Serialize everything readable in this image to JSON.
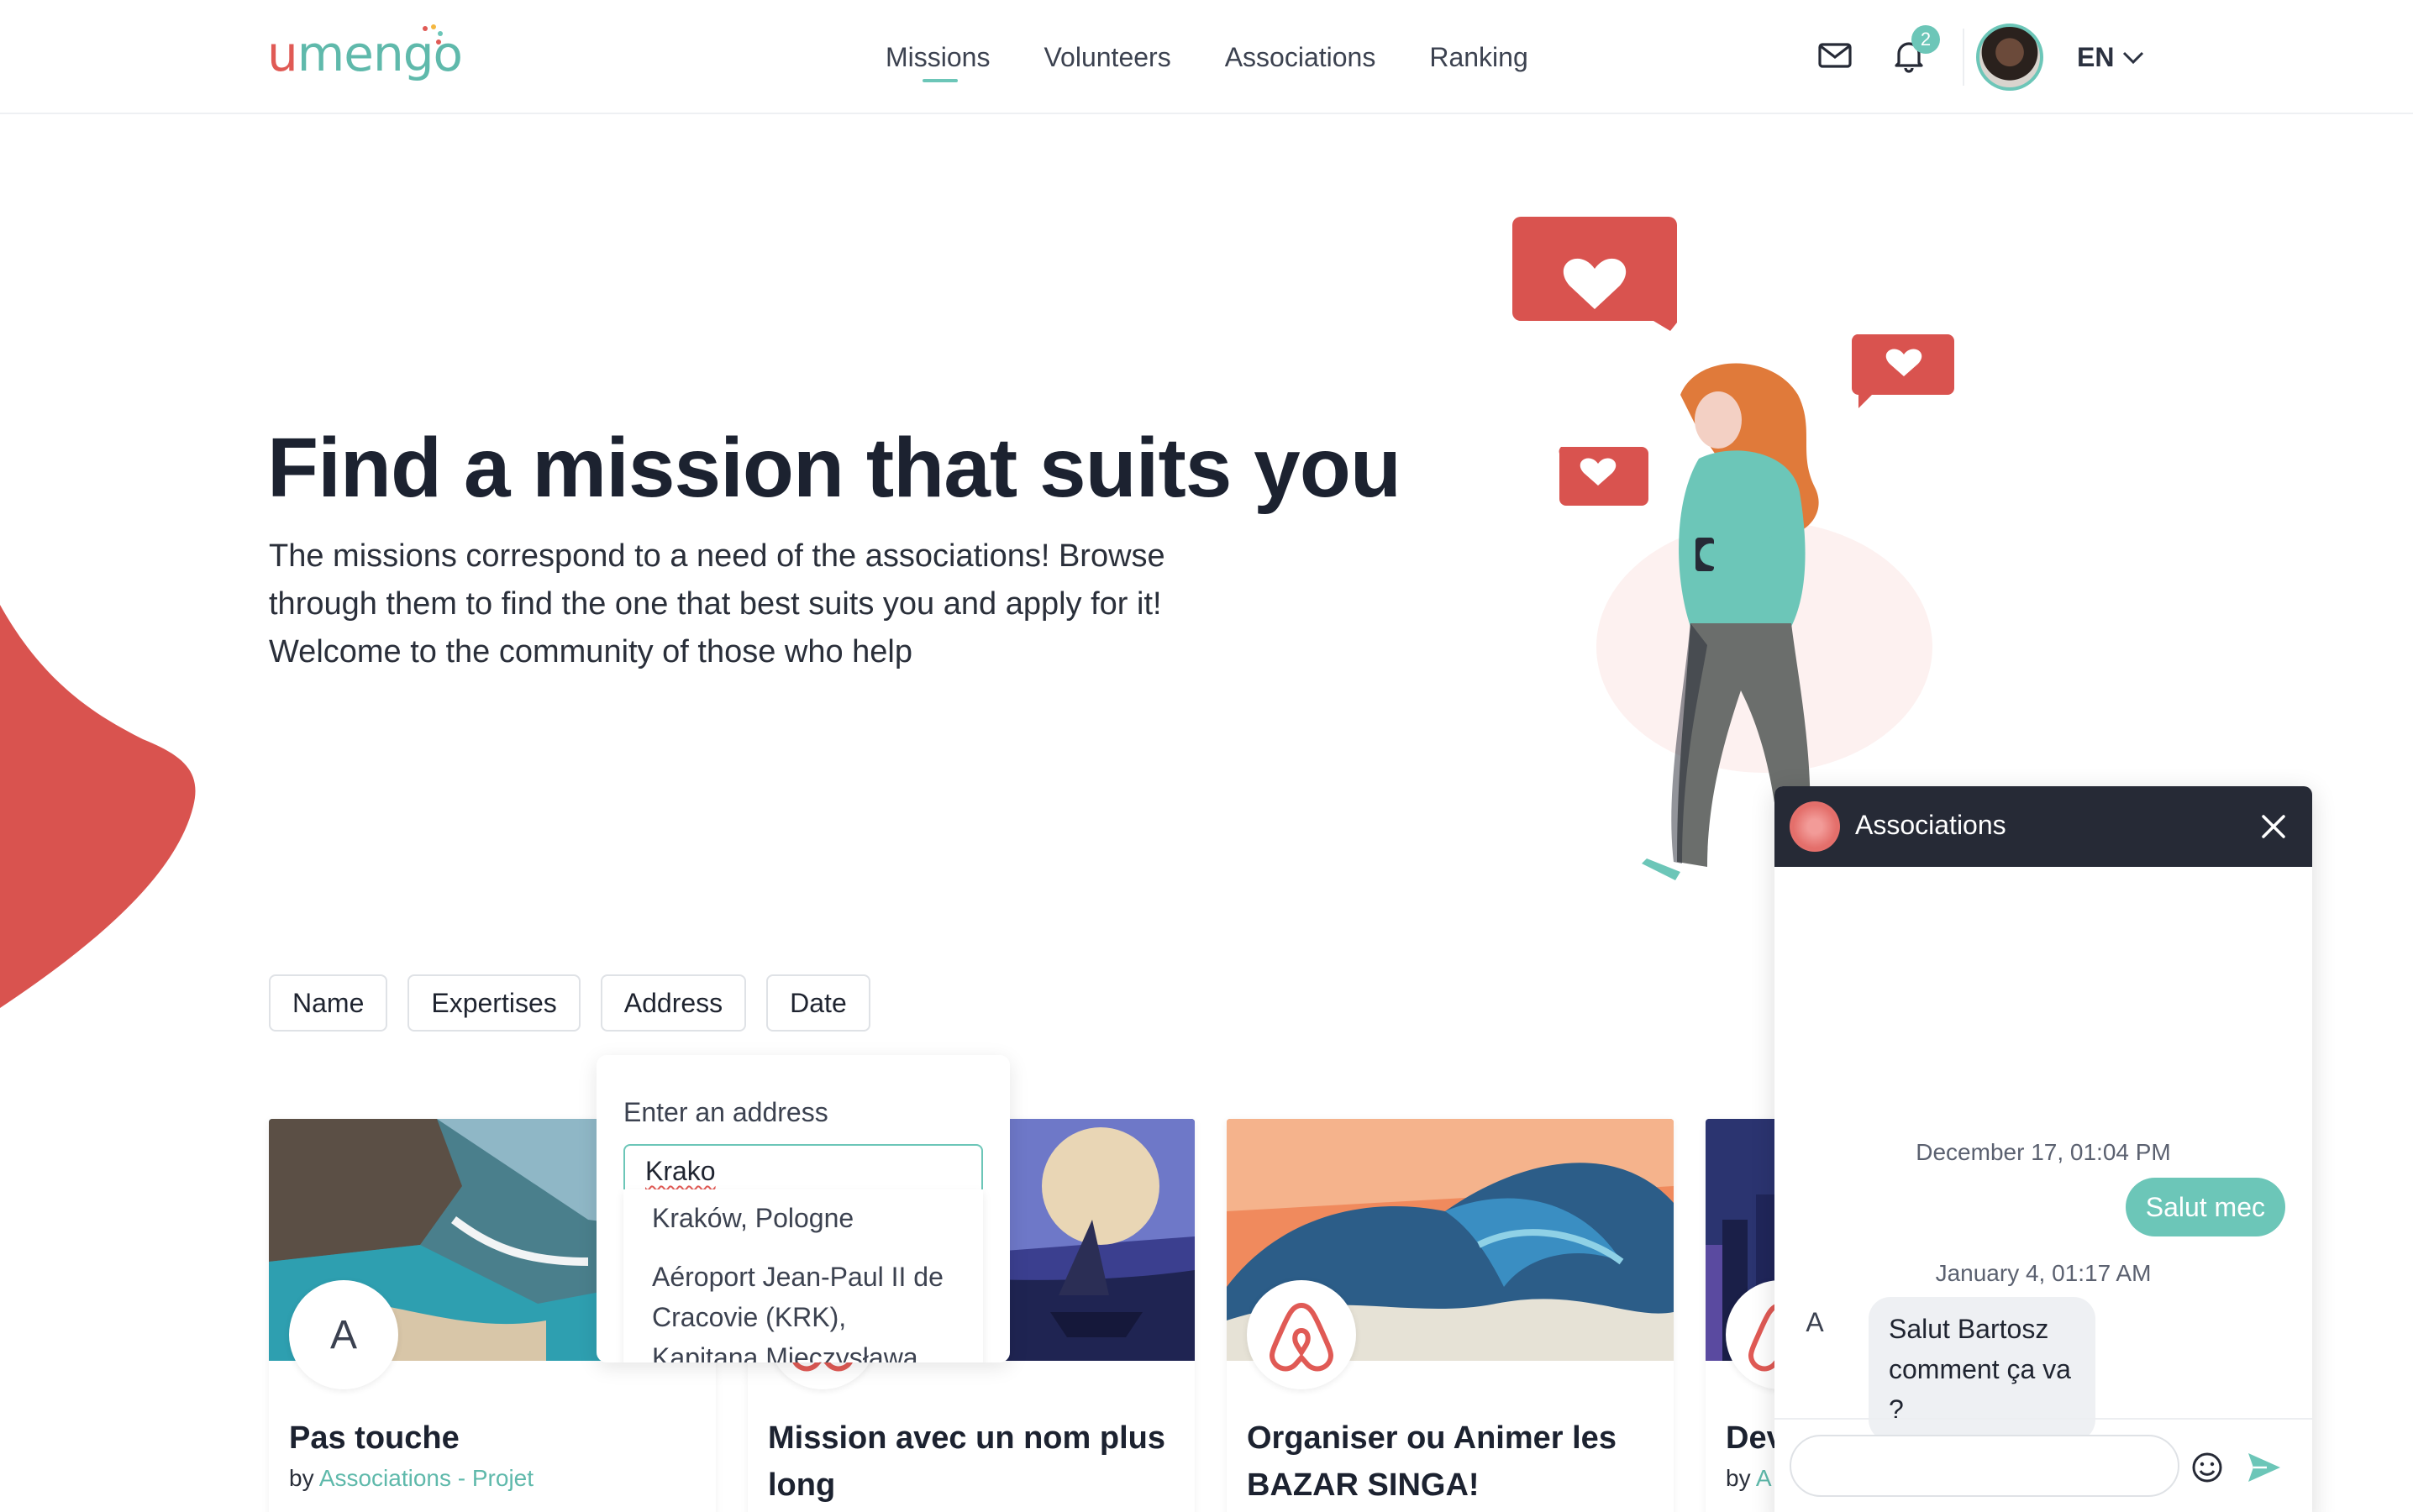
{
  "brand": {
    "name_u": "u",
    "name_rest": "mengo"
  },
  "nav": {
    "links": [
      {
        "label": "Missions",
        "active": true
      },
      {
        "label": "Volunteers",
        "active": false
      },
      {
        "label": "Associations",
        "active": false
      },
      {
        "label": "Ranking",
        "active": false
      }
    ],
    "mail_icon": "mail-icon",
    "bell_icon": "bell-icon",
    "notification_count": "2",
    "language": "EN"
  },
  "hero": {
    "title": "Find a mission that suits you",
    "text": "The missions correspond to a need of the associations! Browse through them to find the one that best suits you and apply for it! Welcome to the community of those who help"
  },
  "filters": [
    "Name",
    "Expertises",
    "Address",
    "Date"
  ],
  "address_dropdown": {
    "label": "Enter an address",
    "input_value": "Krako",
    "suggestions": [
      "Kraków, Pologne",
      "Aéroport Jean-Paul II de Cracovie (KRK), Kapitana Mieczysława"
    ]
  },
  "cards": [
    {
      "title": "Pas touche",
      "by": "by",
      "org": "Associations - Projet",
      "logo_letter": "A"
    },
    {
      "title": "Mission avec un nom plus long",
      "by": "",
      "org": "",
      "logo_letter": ""
    },
    {
      "title": "Organiser ou Animer les BAZAR SINGA!",
      "by": "",
      "org": "",
      "logo_letter": ""
    },
    {
      "title": "Dev",
      "by": "by",
      "org": "A",
      "logo_letter": ""
    }
  ],
  "chat": {
    "title": "Associations",
    "messages": [
      {
        "date": "December 17, 01:04 PM",
        "direction": "out",
        "text": "Salut mec"
      },
      {
        "date": "January 4, 01:17 AM",
        "direction": "in",
        "sender_initial": "A",
        "text": "Salut Bartosz comment ça va ?"
      }
    ]
  },
  "colors": {
    "accent": "#6cc6b8",
    "brand_red": "#e05a55",
    "dark": "#262a36"
  }
}
